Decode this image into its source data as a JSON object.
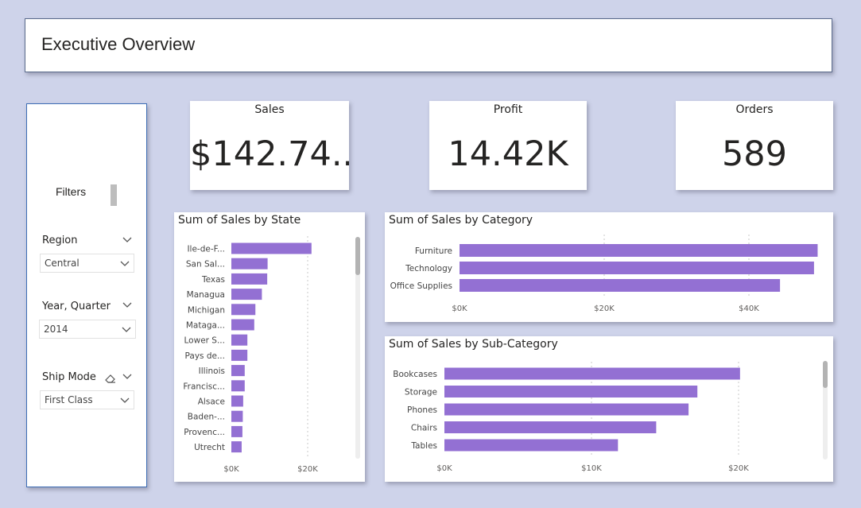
{
  "header": {
    "title": "Executive Overview"
  },
  "filters": {
    "title": "Filters",
    "slicers": [
      {
        "title": "Region",
        "value": "Central"
      },
      {
        "title": "Year, Quarter",
        "value": "2014"
      },
      {
        "title": "Ship Mode",
        "value": "First Class"
      }
    ]
  },
  "kpis": {
    "sales": {
      "title": "Sales",
      "value": "$142.74..."
    },
    "profit": {
      "title": "Profit",
      "value": "14.42K"
    },
    "orders": {
      "title": "Orders",
      "value": "589"
    }
  },
  "colors": {
    "bar": "#9370d3",
    "grid": "#c8c8c8",
    "background": "#ced3ea"
  },
  "chart_data": [
    {
      "type": "bar",
      "orientation": "horizontal",
      "title": "Sum of Sales by State",
      "categories": [
        "Ile-de-F...",
        "San Sal...",
        "Texas",
        "Managua",
        "Michigan",
        "Mataga...",
        "Lower S...",
        "Pays de...",
        "Illinois",
        "Francisc...",
        "Alsace",
        "Baden-...",
        "Provenc...",
        "Utrecht"
      ],
      "values": [
        21000,
        9500,
        9400,
        8000,
        6300,
        6000,
        4200,
        4200,
        3500,
        3500,
        3100,
        3000,
        2900,
        2700
      ],
      "ticks": [
        "$0K",
        "$20K"
      ],
      "xlim": [
        0,
        33000
      ],
      "grid": true
    },
    {
      "type": "bar",
      "orientation": "horizontal",
      "title": "Sum of Sales by Category",
      "categories": [
        "Furniture",
        "Technology",
        "Office Supplies"
      ],
      "values": [
        49500,
        49000,
        44300
      ],
      "ticks": [
        "$0K",
        "$20K",
        "$40K"
      ],
      "xlim": [
        0,
        52000
      ],
      "grid": true
    },
    {
      "type": "bar",
      "orientation": "horizontal",
      "title": "Sum of Sales by Sub-Category",
      "categories": [
        "Bookcases",
        "Storage",
        "Phones",
        "Chairs",
        "Tables"
      ],
      "values": [
        20100,
        17200,
        16600,
        14400,
        11800
      ],
      "ticks": [
        "$0K",
        "$10K",
        "$20K"
      ],
      "xlim": [
        0,
        26000
      ],
      "grid": true
    }
  ]
}
